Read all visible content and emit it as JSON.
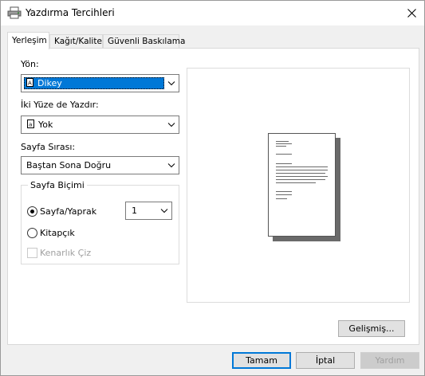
{
  "window": {
    "title": "Yazdırma Tercihleri",
    "icons": {
      "app": "printer-icon",
      "close": "close-icon"
    }
  },
  "tabs": [
    {
      "label": "Yerleşim",
      "active": true
    },
    {
      "label": "Kağıt/Kalite",
      "active": false
    },
    {
      "label": "Güvenli Baskılama",
      "active": false
    }
  ],
  "layout": {
    "orientation": {
      "label": "Yön:",
      "value": "Dikey",
      "icon": "portrait-page-icon"
    },
    "duplex": {
      "label": "İki Yüze de Yazdır:",
      "value": "Yok",
      "icon": "single-sided-page-icon"
    },
    "page_order": {
      "label": "Sayfa Sırası:",
      "value": "Baştan Sona Doğru"
    },
    "page_format": {
      "title": "Sayfa Biçimi",
      "pages_per_sheet_label": "Sayfa/Yaprak",
      "pages_per_sheet_value": "1",
      "booklet_label": "Kitapçık",
      "draw_borders_label": "Kenarlık Çiz",
      "selected": "pages_per_sheet"
    }
  },
  "buttons": {
    "advanced": "Gelişmiş...",
    "ok": "Tamam",
    "cancel": "İptal",
    "help": "Yardım"
  }
}
